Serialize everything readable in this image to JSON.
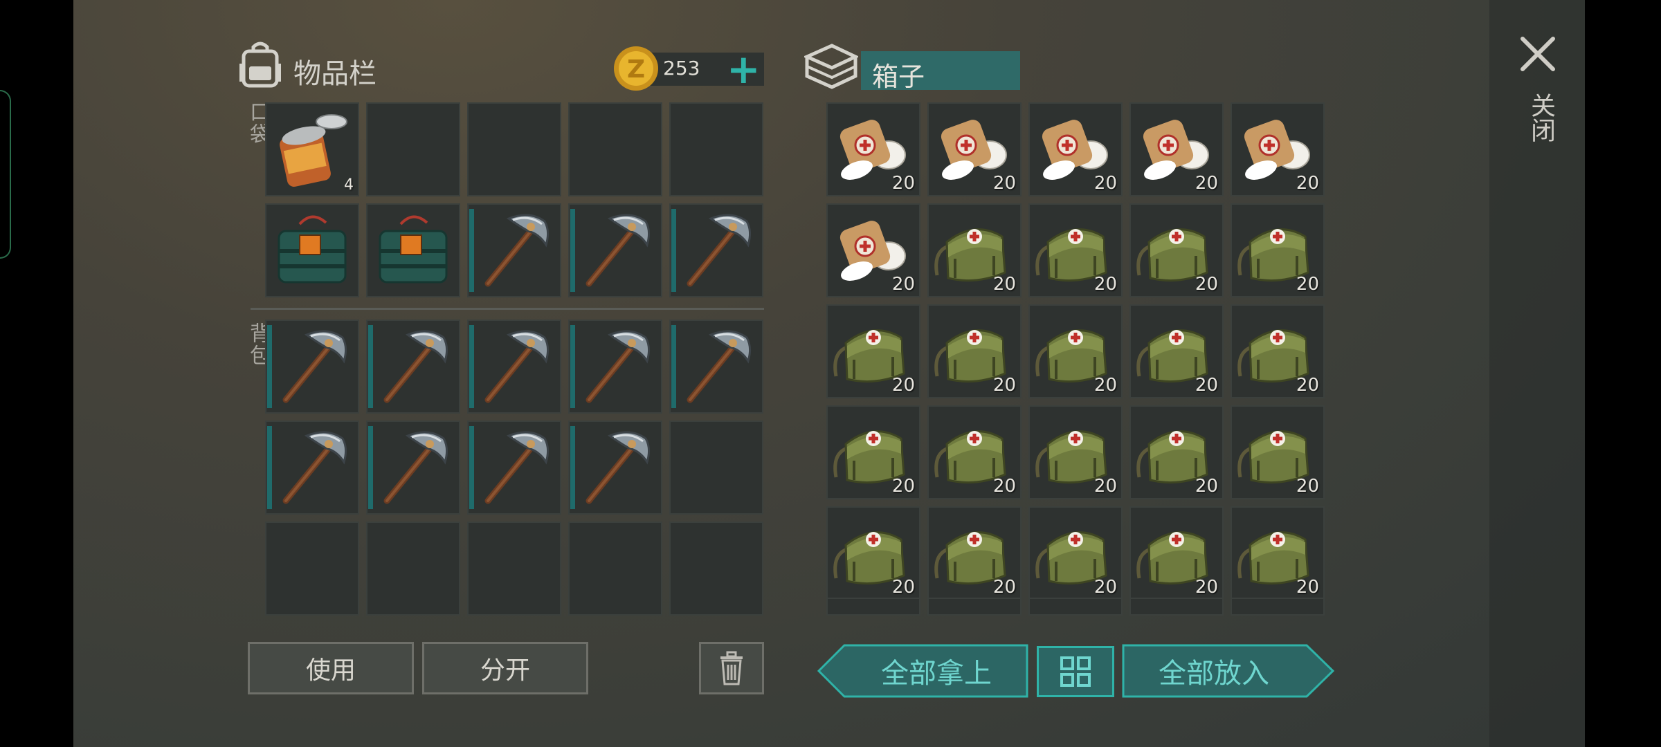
{
  "inventory": {
    "title": "物品栏",
    "coins": "253",
    "pocket_label": "口袋",
    "backpack_label": "背包",
    "use_label": "使用",
    "split_label": "分开"
  },
  "box": {
    "title": "箱子",
    "take_all_label": "全部拿上",
    "put_all_label": "全部放入"
  },
  "close_label": "关闭",
  "pocket_slots": [
    {
      "item": "canned-food",
      "qty": "4"
    },
    {
      "item": "empty"
    },
    {
      "item": "empty"
    },
    {
      "item": "empty"
    },
    {
      "item": "empty"
    },
    {
      "item": "dynamite-pack"
    },
    {
      "item": "dynamite-pack"
    },
    {
      "item": "pickaxe"
    },
    {
      "item": "pickaxe"
    },
    {
      "item": "pickaxe"
    }
  ],
  "backpack_slots": [
    {
      "item": "pickaxe"
    },
    {
      "item": "pickaxe"
    },
    {
      "item": "pickaxe"
    },
    {
      "item": "pickaxe"
    },
    {
      "item": "pickaxe"
    },
    {
      "item": "pickaxe"
    },
    {
      "item": "pickaxe"
    },
    {
      "item": "pickaxe"
    },
    {
      "item": "pickaxe"
    },
    {
      "item": "empty"
    },
    {
      "item": "empty"
    },
    {
      "item": "empty"
    },
    {
      "item": "empty"
    },
    {
      "item": "empty"
    },
    {
      "item": "empty"
    }
  ],
  "box_slots": [
    {
      "item": "bandage",
      "qty": "20"
    },
    {
      "item": "bandage",
      "qty": "20"
    },
    {
      "item": "bandage",
      "qty": "20"
    },
    {
      "item": "bandage",
      "qty": "20"
    },
    {
      "item": "bandage",
      "qty": "20"
    },
    {
      "item": "bandage",
      "qty": "20"
    },
    {
      "item": "medkit-bag",
      "qty": "20"
    },
    {
      "item": "medkit-bag",
      "qty": "20"
    },
    {
      "item": "medkit-bag",
      "qty": "20"
    },
    {
      "item": "medkit-bag",
      "qty": "20"
    },
    {
      "item": "medkit-bag",
      "qty": "20"
    },
    {
      "item": "medkit-bag",
      "qty": "20"
    },
    {
      "item": "medkit-bag",
      "qty": "20"
    },
    {
      "item": "medkit-bag",
      "qty": "20"
    },
    {
      "item": "medkit-bag",
      "qty": "20"
    },
    {
      "item": "medkit-bag",
      "qty": "20"
    },
    {
      "item": "medkit-bag",
      "qty": "20"
    },
    {
      "item": "medkit-bag",
      "qty": "20"
    },
    {
      "item": "medkit-bag",
      "qty": "20"
    },
    {
      "item": "medkit-bag",
      "qty": "20"
    },
    {
      "item": "medkit-bag",
      "qty": "20"
    },
    {
      "item": "medkit-bag",
      "qty": "20"
    },
    {
      "item": "medkit-bag",
      "qty": "20"
    },
    {
      "item": "medkit-bag",
      "qty": "20"
    },
    {
      "item": "medkit-bag",
      "qty": "20"
    }
  ],
  "colors": {
    "accent": "#1f8c86",
    "accent_text": "#6fd6cf",
    "panel": "#2e3230"
  }
}
